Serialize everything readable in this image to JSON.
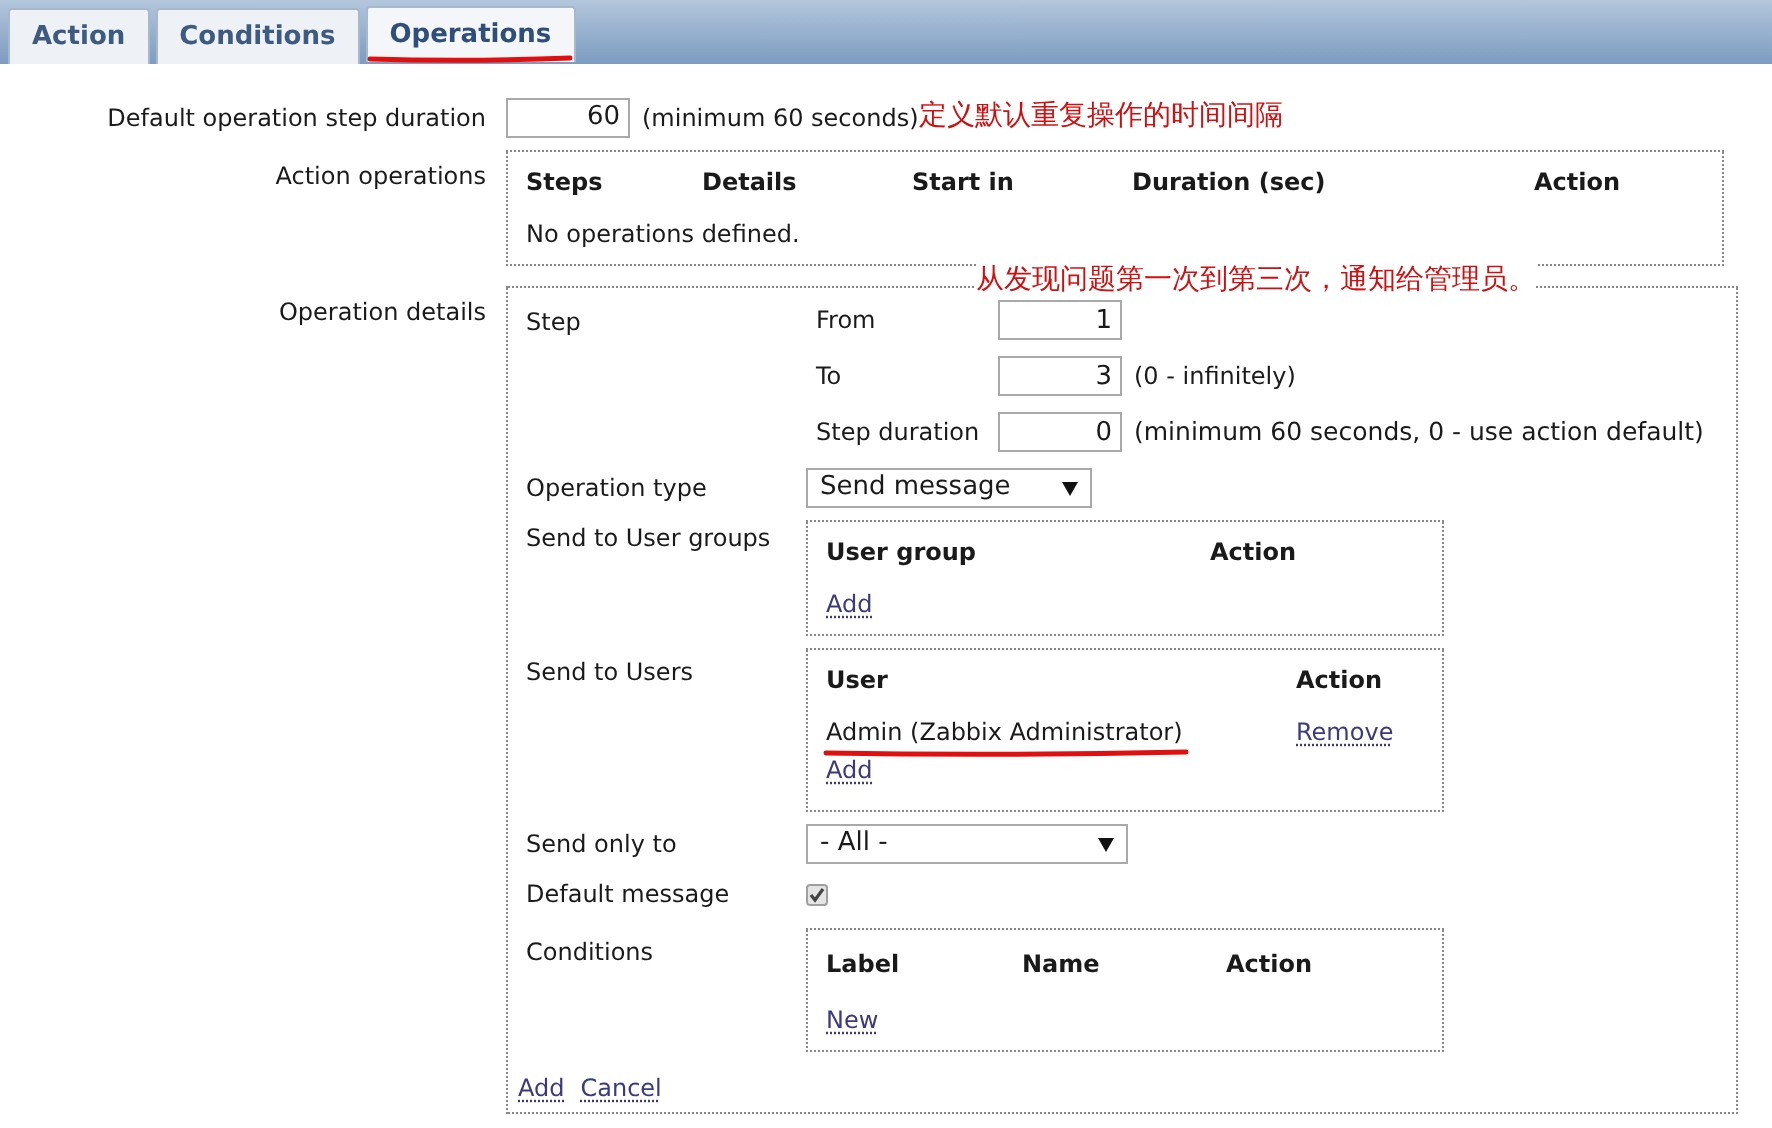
{
  "tabs": [
    {
      "label": "Action",
      "selected": false,
      "underlined": false
    },
    {
      "label": "Conditions",
      "selected": false,
      "underlined": false
    },
    {
      "label": "Operations",
      "selected": true,
      "underlined": true
    }
  ],
  "default_duration": {
    "label": "Default operation step duration",
    "value": "60",
    "hint": "(minimum 60 seconds)",
    "annotation": "定义默认重复操作的时间间隔"
  },
  "action_operations": {
    "label": "Action operations",
    "columns": [
      "Steps",
      "Details",
      "Start in",
      "Duration (sec)",
      "Action"
    ],
    "empty": "No operations defined."
  },
  "operation_details": {
    "label": "Operation details",
    "annotation": "从发现问题第一次到第三次，通知给管理员。",
    "step": {
      "label": "Step",
      "from_label": "From",
      "from": "1",
      "to_label": "To",
      "to": "3",
      "to_hint": "(0 - infinitely)",
      "duration_label": "Step duration",
      "duration": "0",
      "duration_hint": "(minimum 60 seconds, 0 - use action default)"
    },
    "operation_type": {
      "label": "Operation type",
      "value": "Send message"
    },
    "user_groups": {
      "label": "Send to User groups",
      "columns": [
        "User group",
        "Action"
      ],
      "add": "Add"
    },
    "users": {
      "label": "Send to Users",
      "columns": [
        "User",
        "Action"
      ],
      "rows": [
        {
          "user": "Admin (Zabbix Administrator)",
          "action": "Remove",
          "underlined": true
        }
      ],
      "add": "Add"
    },
    "send_only_to": {
      "label": "Send only to",
      "value": "- All -"
    },
    "default_message": {
      "label": "Default message",
      "checked": true
    },
    "conditions": {
      "label": "Conditions",
      "columns": [
        "Label",
        "Name",
        "Action"
      ],
      "add": "New"
    },
    "buttons": [
      "Add",
      "Cancel"
    ]
  }
}
